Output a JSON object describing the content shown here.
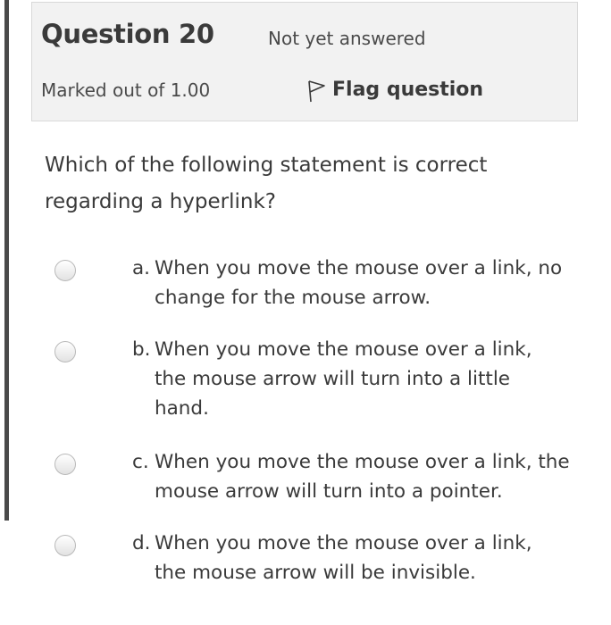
{
  "question": {
    "title": "Question 20",
    "status": "Not yet answered",
    "marks": "Marked out of 1.00",
    "flag_label": "Flag question",
    "flag_icon": "flag-outline-icon"
  },
  "prompt": "Which of the following statement is correct regarding a hyperlink?",
  "options": [
    {
      "letter": "a.",
      "text": "When you move the mouse over a link, no change for the mouse arrow."
    },
    {
      "letter": "b.",
      "text": "When you move the mouse over a link, the mouse arrow will turn into a little hand."
    },
    {
      "letter": "c.",
      "text": "When you move the mouse over a link, the mouse arrow will turn into a pointer."
    },
    {
      "letter": "d.",
      "text": "When you move the mouse over a link, the mouse arrow will be invisible."
    }
  ],
  "colors": {
    "text": "#3a3a3a",
    "info_background": "#f2f2f2",
    "left_rule": "#4a4a4a"
  }
}
